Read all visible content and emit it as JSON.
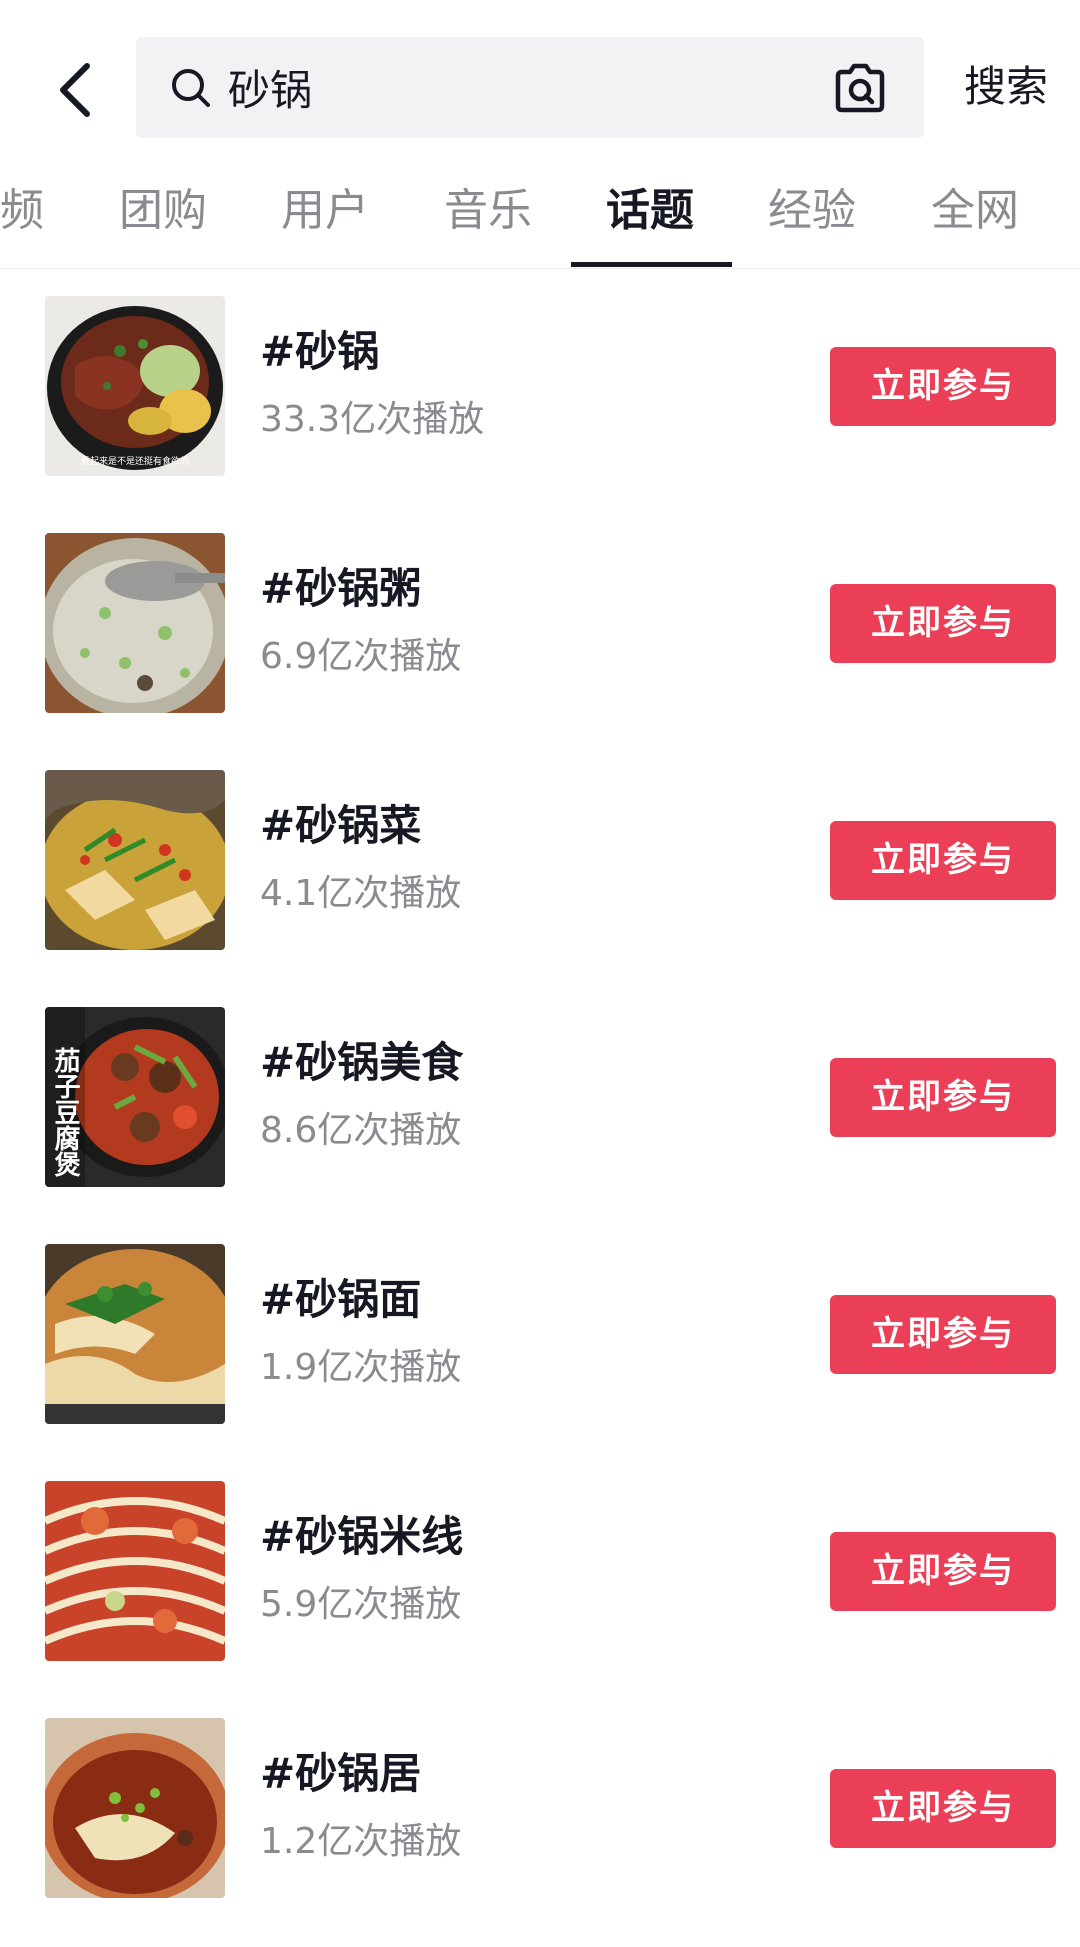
{
  "search": {
    "query": "砂锅",
    "submit_label": "搜索",
    "icons": {
      "back": "back-arrow-icon",
      "search": "search-icon",
      "camera": "camera-search-icon"
    }
  },
  "tabs": [
    {
      "label": "频",
      "active": false
    },
    {
      "label": "团购",
      "active": false
    },
    {
      "label": "用户",
      "active": false
    },
    {
      "label": "音乐",
      "active": false
    },
    {
      "label": "话题",
      "active": true
    },
    {
      "label": "经验",
      "active": false
    },
    {
      "label": "全网",
      "active": false
    }
  ],
  "topics": [
    {
      "title": "#砂锅",
      "plays": "33.3亿次播放",
      "button": "立即参与",
      "thumb_caption": "看起来是不是还挺有食欲的"
    },
    {
      "title": "#砂锅粥",
      "plays": "6.9亿次播放",
      "button": "立即参与"
    },
    {
      "title": "#砂锅菜",
      "plays": "4.1亿次播放",
      "button": "立即参与"
    },
    {
      "title": "#砂锅美食",
      "plays": "8.6亿次播放",
      "button": "立即参与",
      "thumb_caption": "茄子豆腐煲"
    },
    {
      "title": "#砂锅面",
      "plays": "1.9亿次播放",
      "button": "立即参与"
    },
    {
      "title": "#砂锅米线",
      "plays": "5.9亿次播放",
      "button": "立即参与"
    },
    {
      "title": "#砂锅居",
      "plays": "1.2亿次播放",
      "button": "立即参与"
    }
  ],
  "colors": {
    "accent": "#ea3f57",
    "text": "#161823",
    "muted": "#8a8b91",
    "search_bg": "#f2f2f4"
  }
}
